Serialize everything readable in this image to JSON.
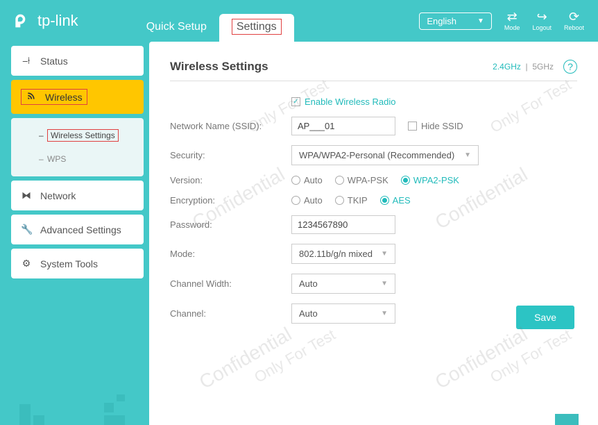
{
  "brand": "tp-link",
  "header": {
    "tabs": {
      "quick_setup": "Quick Setup",
      "settings": "Settings"
    },
    "language": "English",
    "icons": {
      "mode": "Mode",
      "logout": "Logout",
      "reboot": "Reboot"
    }
  },
  "sidebar": {
    "status": "Status",
    "wireless": "Wireless",
    "wireless_sub": {
      "settings": "Wireless Settings",
      "wps": "WPS"
    },
    "network": "Network",
    "advanced": "Advanced Settings",
    "system": "System Tools"
  },
  "page": {
    "title": "Wireless Settings",
    "band_24": "2.4GHz",
    "band_5": "5GHz",
    "enable_label": "Enable Wireless Radio",
    "labels": {
      "ssid": "Network Name (SSID):",
      "security": "Security:",
      "version": "Version:",
      "encryption": "Encryption:",
      "password": "Password:",
      "mode": "Mode:",
      "chwidth": "Channel Width:",
      "channel": "Channel:",
      "hide_ssid": "Hide SSID"
    },
    "values": {
      "ssid": "AP___01",
      "security": "WPA/WPA2-Personal (Recommended)",
      "password": "1234567890",
      "mode": "802.11b/g/n mixed",
      "chwidth": "Auto",
      "channel": "Auto"
    },
    "version_opts": {
      "auto": "Auto",
      "wpa": "WPA-PSK",
      "wpa2": "WPA2-PSK"
    },
    "enc_opts": {
      "auto": "Auto",
      "tkip": "TKIP",
      "aes": "AES"
    },
    "save": "Save"
  },
  "watermarks": {
    "a": "Confidential",
    "b": "Only For Test"
  }
}
